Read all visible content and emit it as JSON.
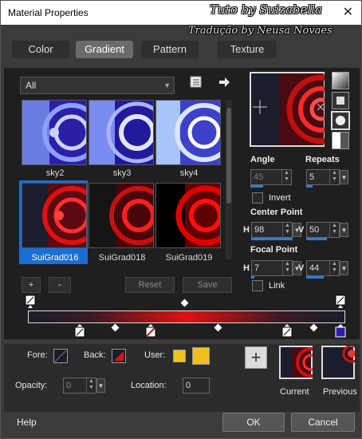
{
  "window": {
    "title": "Material Properties",
    "close_glyph": "✕"
  },
  "watermark": {
    "line1": "Tuto by Suizabella",
    "line2": "Tradução by Neusa Novaes"
  },
  "tabs": [
    {
      "label": "Color",
      "active": false
    },
    {
      "label": "Gradient",
      "active": true
    },
    {
      "label": "Pattern",
      "active": false
    },
    {
      "label": "Texture",
      "active": false
    }
  ],
  "library": {
    "category": "All",
    "items": [
      {
        "label": "sky2",
        "selected": false
      },
      {
        "label": "sky3",
        "selected": false
      },
      {
        "label": "sky4",
        "selected": false
      },
      {
        "label": "SuiGrad016",
        "selected": true
      },
      {
        "label": "SuiGrad018",
        "selected": false
      },
      {
        "label": "SuiGrad019",
        "selected": false
      }
    ],
    "add_label": "+",
    "remove_label": "-",
    "reset_label": "Reset",
    "save_label": "Save"
  },
  "settings": {
    "angle_label": "Angle",
    "angle_value": "45",
    "repeats_label": "Repeats",
    "repeats_value": "5",
    "invert_label": "Invert",
    "center_label": "Center Point",
    "center_h_label": "H",
    "center_h": "98",
    "center_v_label": "V",
    "center_v": "50",
    "focal_label": "Focal Point",
    "focal_h_label": "H",
    "focal_h": "7",
    "focal_v_label": "V",
    "focal_v": "44",
    "link_label": "Link"
  },
  "stops": {
    "fore_label": "Fore:",
    "back_label": "Back:",
    "user_label": "User:",
    "opacity_label": "Opacity:",
    "opacity_value": "0",
    "location_label": "Location:",
    "location_value": "0"
  },
  "preview": {
    "current_label": "Current",
    "previous_label": "Previous",
    "add_glyph": "+"
  },
  "footer": {
    "help_label": "Help",
    "ok_label": "OK",
    "cancel_label": "Cancel"
  },
  "colors": {
    "accent": "#1b6ed1",
    "red": "#e01010",
    "dark": "#1a1d2b",
    "user": "#f0c020"
  }
}
